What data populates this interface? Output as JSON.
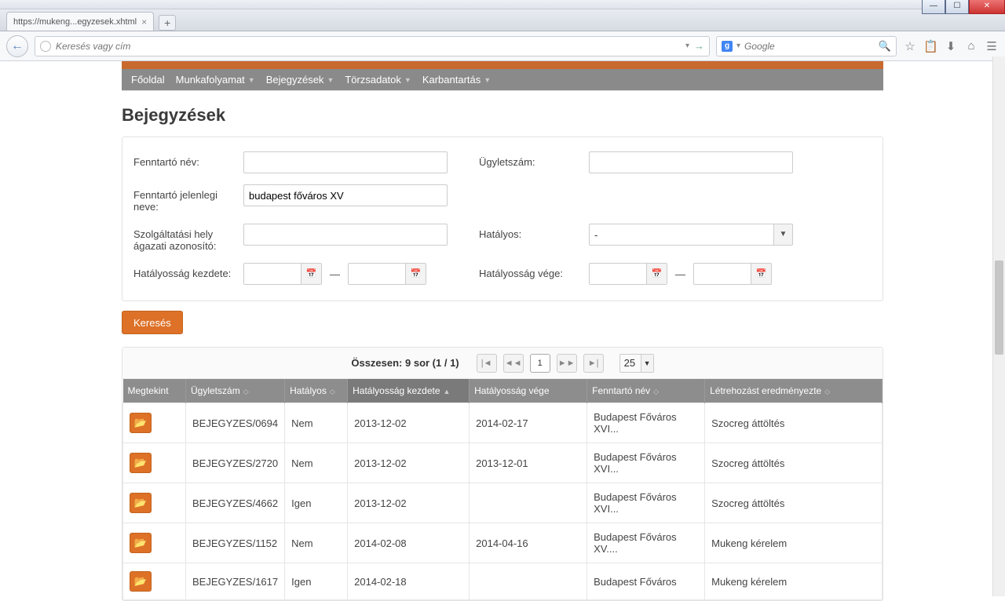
{
  "browser": {
    "tab_title": "https://mukeng...egyzesek.xhtml",
    "url_placeholder": "Keresés vagy cím",
    "search_placeholder": "Google"
  },
  "menu": {
    "items": [
      "Főoldal",
      "Munkafolyamat",
      "Bejegyzések",
      "Törzsadatok",
      "Karbantartás"
    ]
  },
  "page_title": "Bejegyzések",
  "filters": {
    "fenntarto_nev_label": "Fenntartó név:",
    "ugyletszam_label": "Ügyletszám:",
    "fenntarto_jelenlegi_label": "Fenntartó jelenlegi neve:",
    "fenntarto_jelenlegi_value": "budapest főváros XV",
    "szolg_hely_label": "Szolgáltatási hely ágazati azonosító:",
    "hatalyos_label": "Hatályos:",
    "hatalyos_value": "-",
    "hatalyossag_kezdete_label": "Hatályosság kezdete:",
    "hatalyossag_vege_label": "Hatályosság vége:",
    "dash": "—"
  },
  "search_btn": "Keresés",
  "pager": {
    "summary": "Összesen: 9 sor (1 / 1)",
    "first": "|◄",
    "prev": "◄◄",
    "page": "1",
    "next": "►►",
    "last": "►|",
    "pagesize": "25"
  },
  "columns": {
    "view": "Megtekint",
    "ugyletszam": "Ügyletszám",
    "hatalyos": "Hatályos",
    "kezdete": "Hatályosság kezdete",
    "vege": "Hatályosság vége",
    "fenntarto": "Fenntartó név",
    "letrehozas": "Létrehozást eredményezte"
  },
  "rows": [
    {
      "ugy": "BEJEGYZES/0694",
      "hat": "Nem",
      "kezd": "2013-12-02",
      "vege": "2014-02-17",
      "fenn": "Budapest Főváros XVI...",
      "letr": "Szocreg áttöltés"
    },
    {
      "ugy": "BEJEGYZES/2720",
      "hat": "Nem",
      "kezd": "2013-12-02",
      "vege": "2013-12-01",
      "fenn": "Budapest Főváros XVI...",
      "letr": "Szocreg áttöltés"
    },
    {
      "ugy": "BEJEGYZES/4662",
      "hat": "Igen",
      "kezd": "2013-12-02",
      "vege": "",
      "fenn": "Budapest Főváros XVI...",
      "letr": "Szocreg áttöltés"
    },
    {
      "ugy": "BEJEGYZES/1152",
      "hat": "Nem",
      "kezd": "2014-02-08",
      "vege": "2014-04-16",
      "fenn": "Budapest Főváros XV....",
      "letr": "Mukeng kérelem"
    },
    {
      "ugy": "BEJEGYZES/1617",
      "hat": "Igen",
      "kezd": "2014-02-18",
      "vege": "",
      "fenn": "Budapest Főváros",
      "letr": "Mukeng kérelem"
    }
  ]
}
